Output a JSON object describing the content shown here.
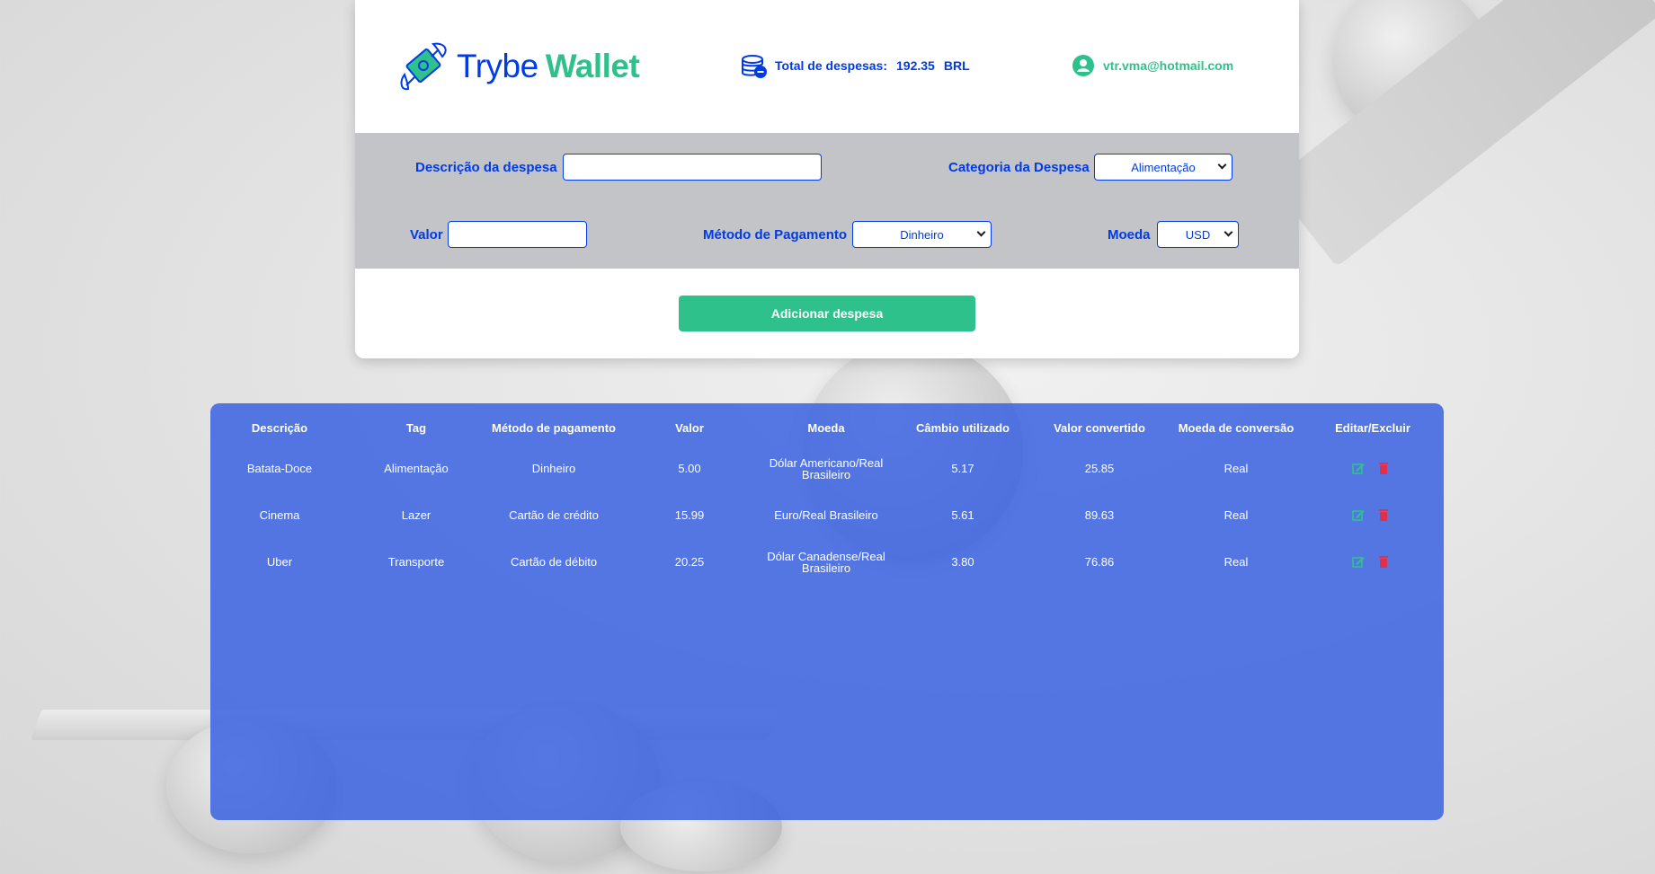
{
  "logo": {
    "part1": "Trybe",
    "part2": "Wallet",
    "icon": "flying-money-icon"
  },
  "header": {
    "total_label": "Total de despesas:",
    "total_value": "192.35",
    "total_currency": "BRL",
    "total_icon": "coins-icon",
    "user_email": "vtr.vma@hotmail.com",
    "user_icon": "user-avatar-icon"
  },
  "form": {
    "description_label": "Descrição da despesa",
    "description_value": "",
    "category_label": "Categoria da Despesa",
    "category_value": "Alimentação",
    "value_label": "Valor",
    "value_value": "",
    "method_label": "Método de Pagamento",
    "method_value": "Dinheiro",
    "currency_label": "Moeda",
    "currency_value": "USD",
    "submit_label": "Adicionar despesa"
  },
  "table": {
    "headers": [
      "Descrição",
      "Tag",
      "Método de pagamento",
      "Valor",
      "Moeda",
      "Câmbio utilizado",
      "Valor convertido",
      "Moeda de conversão",
      "Editar/Excluir"
    ],
    "rows": [
      [
        "Batata-Doce",
        "Alimentação",
        "Dinheiro",
        "5.00",
        "Dólar Americano/Real Brasileiro",
        "5.17",
        "25.85",
        "Real"
      ],
      [
        "Cinema",
        "Lazer",
        "Cartão de crédito",
        "15.99",
        "Euro/Real Brasileiro",
        "5.61",
        "89.63",
        "Real"
      ],
      [
        "Uber",
        "Transporte",
        "Cartão de débito",
        "20.25",
        "Dólar Canadense/Real Brasileiro",
        "3.80",
        "76.86",
        "Real"
      ]
    ],
    "edit_icon": "edit-icon",
    "delete_icon": "trash-icon"
  },
  "colors": {
    "brand_blue": "#003be5",
    "brand_green": "#2fc18c",
    "delete_red": "#e0304b",
    "table_bg": "#3b63e1"
  }
}
